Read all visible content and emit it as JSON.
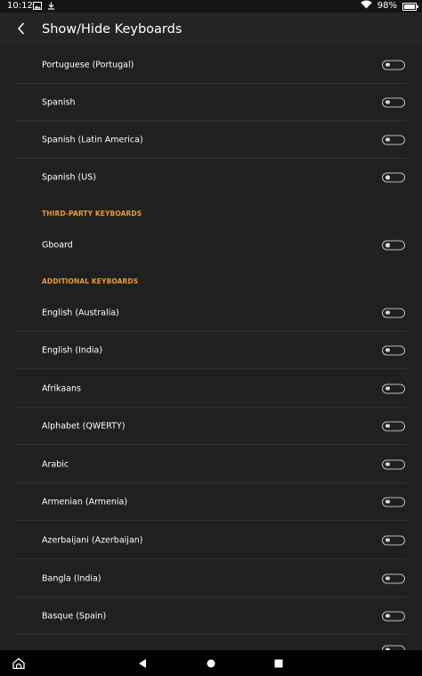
{
  "status_bar": {
    "time": "10:12",
    "battery_text": "98%",
    "battery_level": 0.98,
    "icons_left": [
      "image-icon",
      "download-icon"
    ],
    "icons_right": [
      "wifi-icon",
      "battery-icon"
    ]
  },
  "app_bar": {
    "back_icon": "chevron-left-icon",
    "title": "Show/Hide Keyboards"
  },
  "rows_top": [
    {
      "label": "Portuguese (Portugal)",
      "enabled": false
    },
    {
      "label": "Spanish",
      "enabled": false
    },
    {
      "label": "Spanish (Latin America)",
      "enabled": false
    },
    {
      "label": "Spanish (US)",
      "enabled": false
    }
  ],
  "section_third_party": "THIRD-PARTY KEYBOARDS",
  "rows_third_party": [
    {
      "label": "Gboard",
      "enabled": false
    }
  ],
  "section_additional": "ADDITIONAL KEYBOARDS",
  "rows_additional": [
    {
      "label": "English (Australia)",
      "enabled": false
    },
    {
      "label": "English (India)",
      "enabled": false
    },
    {
      "label": "Afrikaans",
      "enabled": false
    },
    {
      "label": "Alphabet (QWERTY)",
      "enabled": false
    },
    {
      "label": "Arabic",
      "enabled": false
    },
    {
      "label": "Armenian (Armenia)",
      "enabled": false
    },
    {
      "label": "Azerbaijani (Azerbaijan)",
      "enabled": false
    },
    {
      "label": "Bangla (India)",
      "enabled": false
    },
    {
      "label": "Basque (Spain)",
      "enabled": false
    }
  ],
  "nav_bar": {
    "home_icon": "fire-home-icon",
    "back_icon": "triangle-back-icon",
    "home_circle_icon": "circle-home-icon",
    "recents_icon": "square-recents-icon"
  },
  "colors": {
    "background": "#202020",
    "app_bar": "#242424",
    "section_header": "#e79a3c",
    "divider": "#323232",
    "toggle_outline": "#bdbdbd"
  }
}
